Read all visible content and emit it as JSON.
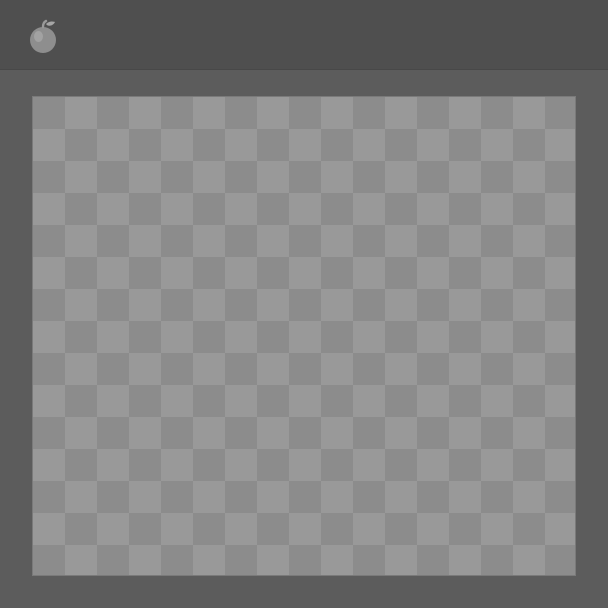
{
  "app": {
    "logo_icon": "apple-icon",
    "colors": {
      "titlebar": "#4f4f4f",
      "workspace": "#5c5c5c",
      "checker_light": "#999999",
      "checker_dark": "#8c8c8c"
    }
  },
  "canvas": {
    "background": "transparent-checkerboard"
  }
}
